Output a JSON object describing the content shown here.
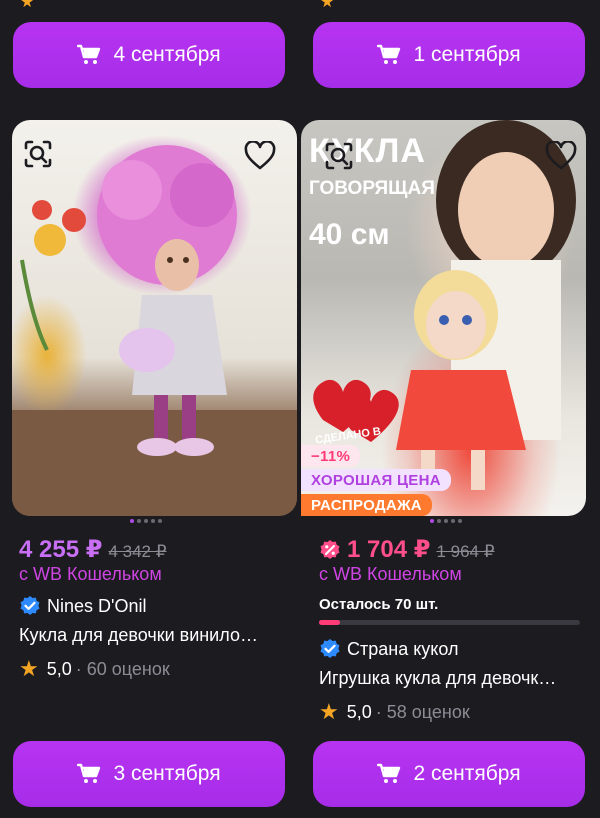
{
  "top_row": {
    "left_button": {
      "label": "4 сентября"
    },
    "right_button": {
      "label": "1 сентября"
    }
  },
  "products": [
    {
      "price": "4 255 ₽",
      "old_price": "4 342 ₽",
      "wallet_note": "с WB Кошельком",
      "seller": "Nines D'Onil",
      "title": "Кукла для девочки винило…",
      "rating": "5,0",
      "reviews": "· 60 оценок",
      "button_label": "3 сентября",
      "price_color": "#c86ff5"
    },
    {
      "price": "1 704 ₽",
      "old_price": "1 964 ₽",
      "wallet_note": "с WB Кошельком",
      "stock_note": "Осталось 70 шт.",
      "stock_level": 0.08,
      "seller": "Страна кукол",
      "title": "Игрушка кукла для девочк…",
      "rating": "5,0",
      "reviews": "· 58 оценок",
      "button_label": "2 сентября",
      "price_color": "#ff4f8b",
      "badges": {
        "discount": "−11%",
        "good_price": "ХОРОШАЯ ЦЕНА",
        "sale": "РАСПРОДАЖА"
      },
      "image_overlay": {
        "line1": "КУКЛА",
        "line2": "ГОВОРЯЩАЯ",
        "line3": "40 см",
        "heart_text": "СДЕЛАНО В"
      }
    }
  ],
  "colors": {
    "button": "#b330f0",
    "wallet": "#cf45e3",
    "verified": "#2e8bff",
    "star": "#f5a524",
    "discount_badge_bg": "#fde6ee",
    "discount_badge_text": "#ff3c78",
    "good_price_bg": "#f3e2ff",
    "good_price_text": "#b040e0",
    "sale_bg": "#ff7a2e"
  }
}
